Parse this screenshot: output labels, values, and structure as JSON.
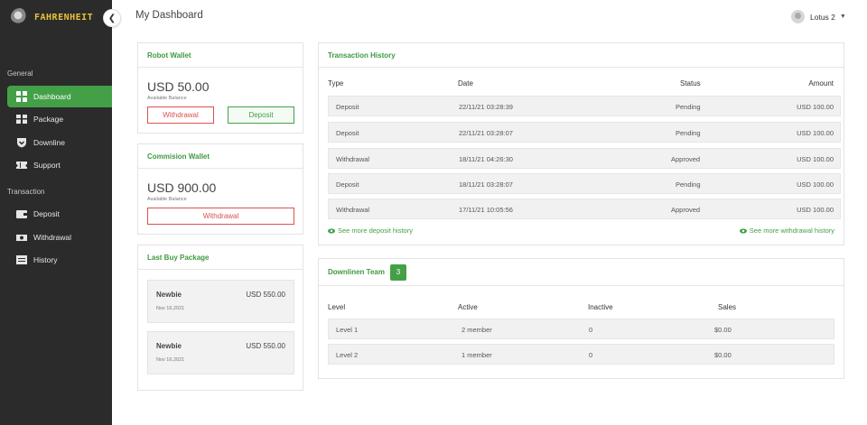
{
  "brand": {
    "name": "FAHRENHEIT"
  },
  "sidebar": {
    "sections": [
      {
        "label": "General",
        "items": [
          {
            "label": "Dashboard",
            "icon": "grid-icon",
            "active": true
          },
          {
            "label": "Package",
            "icon": "package-icon"
          },
          {
            "label": "Downline",
            "icon": "shield-icon"
          },
          {
            "label": "Support",
            "icon": "ticket-icon"
          }
        ]
      },
      {
        "label": "Transaction",
        "items": [
          {
            "label": "Deposit",
            "icon": "wallet-icon"
          },
          {
            "label": "Withdrawal",
            "icon": "cash-icon"
          },
          {
            "label": "History",
            "icon": "list-icon"
          }
        ]
      }
    ]
  },
  "header": {
    "title": "My Dashboard",
    "user": "Lotus 2"
  },
  "robot_wallet": {
    "title": "Robot Wallet",
    "amount": "USD 50.00",
    "sub": "Available Balance",
    "withdraw_label": "Withdrawal",
    "deposit_label": "Deposit"
  },
  "commision_wallet": {
    "title": "Commision Wallet",
    "amount": "USD 900.00",
    "sub": "Available Balance",
    "withdraw_label": "Withdrawal"
  },
  "last_buy": {
    "title": "Last Buy Package",
    "packages": [
      {
        "name": "Newbie",
        "price": "USD 550.00",
        "date": "Nov 16,2021"
      },
      {
        "name": "Newbie",
        "price": "USD 550.00",
        "date": "Nov 16,2021"
      }
    ]
  },
  "transactions": {
    "title": "Transaction History",
    "columns": [
      "Type",
      "Date",
      "Status",
      "Amount"
    ],
    "rows": [
      {
        "type": "Deposit",
        "date": "22/11/21 03:28:39",
        "status": "Pending",
        "amount": "USD 100.00"
      },
      {
        "type": "Deposit",
        "date": "22/11/21 03:28:07",
        "status": "Pending",
        "amount": "USD 100.00"
      },
      {
        "type": "Withdrawal",
        "date": "18/11/21 04:26:30",
        "status": "Approved",
        "amount": "USD 100.00"
      },
      {
        "type": "Deposit",
        "date": "18/11/21 03:28:07",
        "status": "Pending",
        "amount": "USD 100.00"
      },
      {
        "type": "Withdrawal",
        "date": "17/11/21 10:05:56",
        "status": "Approved",
        "amount": "USD 100.00"
      }
    ],
    "deposit_link": "See more deposit history",
    "withdrawal_link": "See more withdrawal history"
  },
  "downline": {
    "title": "Downlinen Team",
    "count": "3",
    "columns": [
      "Level",
      "Active",
      "Inactive",
      "Sales"
    ],
    "rows": [
      {
        "level": "Level 1",
        "active": "2 member",
        "inactive": "0",
        "sales": "$0.00"
      },
      {
        "level": "Level 2",
        "active": "1 member",
        "inactive": "0",
        "sales": "$0.00"
      }
    ]
  },
  "colors": {
    "accent": "#44a047",
    "sidebar": "#2b2b2b",
    "danger": "#d9534f"
  }
}
